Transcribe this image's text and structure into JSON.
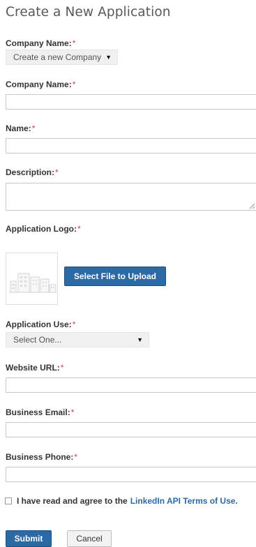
{
  "page": {
    "title": "Create a New Application"
  },
  "required_marker": "*",
  "company_select": {
    "label": "Company Name:",
    "value": "Create a new Company",
    "caret": "▼"
  },
  "company_name": {
    "label": "Company Name:",
    "value": ""
  },
  "name": {
    "label": "Name:",
    "value": ""
  },
  "description": {
    "label": "Description:",
    "value": ""
  },
  "logo": {
    "label": "Application Logo:",
    "upload_label": "Select File to Upload",
    "placeholder_icon": "buildings-icon"
  },
  "application_use": {
    "label": "Application Use:",
    "value": "Select One...",
    "caret": "▼"
  },
  "website_url": {
    "label": "Website URL:",
    "value": ""
  },
  "business_email": {
    "label": "Business Email:",
    "value": ""
  },
  "business_phone": {
    "label": "Business Phone:",
    "value": ""
  },
  "agreement": {
    "text": "I have read and agree to the",
    "link": "LinkedIn API Terms of Use.",
    "checked": false
  },
  "actions": {
    "submit_label": "Submit",
    "cancel_label": "Cancel"
  },
  "colors": {
    "primary": "#2c6aa5",
    "required": "#dd3b3b",
    "title": "#595959"
  }
}
